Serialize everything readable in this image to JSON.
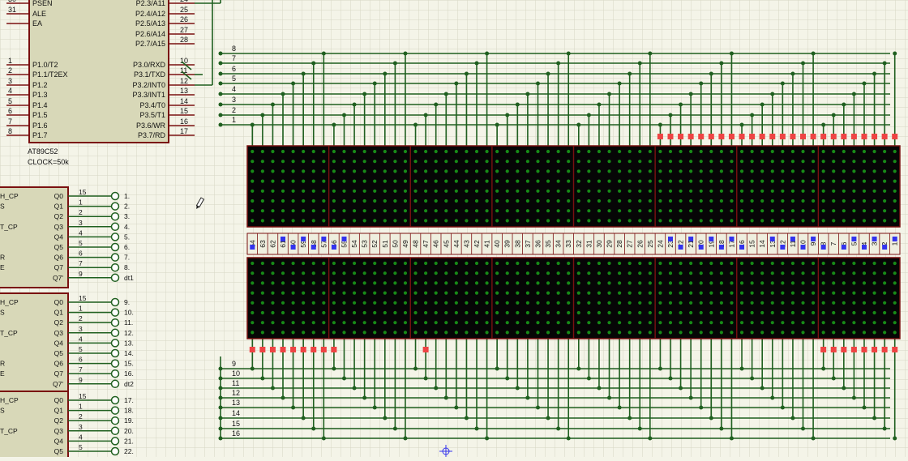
{
  "app": {
    "title": "Proteus ISIS schematic - LED matrix"
  },
  "colors": {
    "background": "#f4f4e8",
    "grid": "#d6d6c4",
    "wire": "#1f5f1f",
    "component_border": "#7a1010",
    "component_fill": "#d8d8b8",
    "matrix_fill": "#060606",
    "led_on": "#178a17",
    "pin_red": "#ee4444",
    "pin_blue": "#3333ee"
  },
  "mcu": {
    "part": "AT89C52",
    "clock": "CLOCK=50k",
    "left_pins": [
      {
        "num": "30",
        "name": "PSEN"
      },
      {
        "num": "31",
        "name": "ALE"
      },
      {
        "num": "",
        "name": "EA"
      },
      {
        "num": "1",
        "name": "P1.0/T2"
      },
      {
        "num": "2",
        "name": "P1.1/T2EX"
      },
      {
        "num": "3",
        "name": "P1.2"
      },
      {
        "num": "4",
        "name": "P1.3"
      },
      {
        "num": "5",
        "name": "P1.4"
      },
      {
        "num": "6",
        "name": "P1.5"
      },
      {
        "num": "7",
        "name": "P1.6"
      },
      {
        "num": "8",
        "name": "P1.7"
      }
    ],
    "right_pins": [
      {
        "num": "24",
        "name": "P2.3/A11"
      },
      {
        "num": "25",
        "name": "P2.4/A12"
      },
      {
        "num": "26",
        "name": "P2.5/A13"
      },
      {
        "num": "27",
        "name": "P2.6/A14"
      },
      {
        "num": "28",
        "name": "P2.7/A15"
      },
      {
        "num": "10",
        "name": "P3.0/RXD"
      },
      {
        "num": "11",
        "name": "P3.1/TXD"
      },
      {
        "num": "12",
        "name": "P3.2/INT0"
      },
      {
        "num": "13",
        "name": "P3.3/INT1"
      },
      {
        "num": "14",
        "name": "P3.4/T0"
      },
      {
        "num": "15",
        "name": "P3.5/T1"
      },
      {
        "num": "16",
        "name": "P3.6/WR"
      },
      {
        "num": "17",
        "name": "P3.7/RD"
      }
    ]
  },
  "shift_registers": [
    {
      "left_labels": [
        "H_CP",
        "S",
        "",
        "T_CP",
        "",
        "",
        "R",
        "E"
      ],
      "pins": [
        {
          "name": "Q0",
          "num": "15",
          "net": "1."
        },
        {
          "name": "Q1",
          "num": "1",
          "net": "2."
        },
        {
          "name": "Q2",
          "num": "2",
          "net": "3."
        },
        {
          "name": "Q3",
          "num": "3",
          "net": "4."
        },
        {
          "name": "Q4",
          "num": "4",
          "net": "5."
        },
        {
          "name": "Q5",
          "num": "5",
          "net": "6."
        },
        {
          "name": "Q6",
          "num": "6",
          "net": "7."
        },
        {
          "name": "Q7",
          "num": "7",
          "net": "8."
        },
        {
          "name": "Q7'",
          "num": "9",
          "net": "dt1"
        }
      ]
    },
    {
      "left_labels": [
        "H_CP",
        "S",
        "",
        "T_CP",
        "",
        "",
        "R",
        "E"
      ],
      "pins": [
        {
          "name": "Q0",
          "num": "15",
          "net": "9."
        },
        {
          "name": "Q1",
          "num": "1",
          "net": "10."
        },
        {
          "name": "Q2",
          "num": "2",
          "net": "11."
        },
        {
          "name": "Q3",
          "num": "3",
          "net": "12."
        },
        {
          "name": "Q4",
          "num": "4",
          "net": "13."
        },
        {
          "name": "Q5",
          "num": "5",
          "net": "14."
        },
        {
          "name": "Q6",
          "num": "6",
          "net": "15."
        },
        {
          "name": "Q7",
          "num": "7",
          "net": "16."
        },
        {
          "name": "Q7'",
          "num": "9",
          "net": "dt2"
        }
      ]
    },
    {
      "left_labels": [
        "H_CP",
        "S",
        "",
        "T_CP",
        ""
      ],
      "pins": [
        {
          "name": "Q0",
          "num": "15",
          "net": "17."
        },
        {
          "name": "Q1",
          "num": "1",
          "net": "18."
        },
        {
          "name": "Q2",
          "num": "2",
          "net": "19."
        },
        {
          "name": "Q3",
          "num": "3",
          "net": "20."
        },
        {
          "name": "Q4",
          "num": "4",
          "net": "21."
        },
        {
          "name": "Q5",
          "num": "5",
          "net": "22."
        }
      ]
    }
  ],
  "top_bus_labels": [
    "8",
    "7",
    "6",
    "5",
    "4",
    "3",
    "2",
    "1"
  ],
  "bottom_bus_labels": [
    "9",
    "10",
    "11",
    "12",
    "13",
    "14",
    "15",
    "16"
  ],
  "column_labels": [
    "64",
    "63",
    "62",
    "61",
    "60",
    "59",
    "58",
    "57",
    "56",
    "55",
    "54",
    "53",
    "52",
    "51",
    "50",
    "49",
    "48",
    "47",
    "46",
    "45",
    "44",
    "43",
    "42",
    "41",
    "40",
    "39",
    "38",
    "37",
    "36",
    "35",
    "34",
    "33",
    "32",
    "31",
    "30",
    "29",
    "28",
    "27",
    "26",
    "25",
    "24",
    "23",
    "22",
    "21",
    "20",
    "19",
    "18",
    "17",
    "16",
    "15",
    "14",
    "13",
    "12",
    "11",
    "10",
    "9",
    "8",
    "7",
    "6",
    "5",
    "4",
    "3",
    "2",
    "1"
  ]
}
